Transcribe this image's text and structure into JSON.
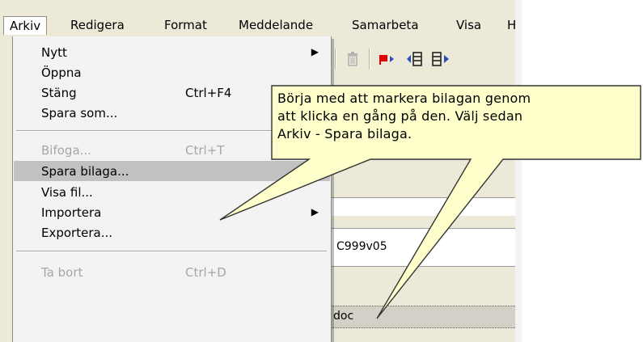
{
  "menubar": {
    "items": [
      "Arkiv",
      "Redigera",
      "Format",
      "Meddelande",
      "Samarbeta",
      "Visa",
      "H"
    ]
  },
  "menu": {
    "groups": [
      [
        {
          "label": "Nytt",
          "shortcut": "",
          "submenu": true,
          "disabled": false
        },
        {
          "label": "Öppna",
          "shortcut": "",
          "submenu": false,
          "disabled": false
        },
        {
          "label": "Stäng",
          "shortcut": "Ctrl+F4",
          "submenu": false,
          "disabled": false
        },
        {
          "label": "Spara som...",
          "shortcut": "",
          "submenu": false,
          "disabled": false
        }
      ],
      [
        {
          "label": "Bifoga...",
          "shortcut": "Ctrl+T",
          "submenu": false,
          "disabled": true
        },
        {
          "label": "Spara bilaga...",
          "shortcut": "",
          "submenu": false,
          "disabled": false,
          "selected": true
        },
        {
          "label": "Visa fil...",
          "shortcut": "",
          "submenu": false,
          "disabled": false
        },
        {
          "label": "Importera",
          "shortcut": "",
          "submenu": true,
          "disabled": false
        },
        {
          "label": "Exportera...",
          "shortcut": "",
          "submenu": false,
          "disabled": false
        }
      ],
      [
        {
          "label": "Ta bort",
          "shortcut": "Ctrl+D",
          "submenu": false,
          "disabled": true
        }
      ]
    ]
  },
  "toolbar": {
    "icons": [
      "trash-icon",
      "flag-next-icon",
      "previous-message-icon",
      "next-message-icon"
    ]
  },
  "fields": {
    "subject_value": "C999v05",
    "attachment_name": "doc"
  },
  "callout": {
    "lines": [
      "Börja med att markera bilagan genom",
      "att klicka en gång på den. Välj sedan",
      "Arkiv - Spara bilaga."
    ],
    "fill": "#ffffcc",
    "stroke": "#333333"
  },
  "colors": {
    "menubar_bg": "#ece9d8",
    "menu_bg": "#f3f3f3",
    "selected_bg": "#c1c1c1",
    "disabled_text": "#a6a6a6",
    "flag_red": "#e00000"
  }
}
